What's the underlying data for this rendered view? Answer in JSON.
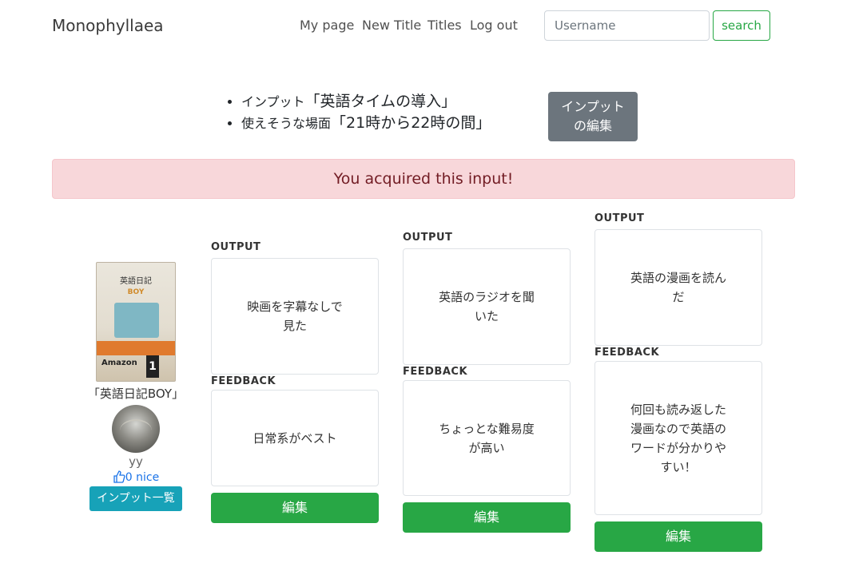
{
  "navbar": {
    "brand": "Monophyllaea",
    "links": [
      "My page",
      "New Title",
      "Titles",
      "Log out"
    ],
    "search_placeholder": "Username",
    "search_button": "search"
  },
  "input_info": {
    "input_prefix": "インプット",
    "input_value": "「英語タイムの導入」",
    "scene_prefix": "使えそうな場面",
    "scene_value": "「21時から22時の間」",
    "edit_button_line1": "インプット",
    "edit_button_line2": "の編集"
  },
  "alert": "You acquired this input!",
  "profile": {
    "book_label": "「英語日記BOY」",
    "book_cover_title": "英語日記",
    "book_cover_subtitle": "BOY",
    "book_cover_amazon": "Amazon",
    "book_cover_number": "1",
    "username": "yy",
    "nice": "0 nice",
    "list_button": "インプット一覧"
  },
  "records": [
    {
      "output_label": "OUTPUT",
      "output": "映画を字幕なしで見た",
      "feedback_label": "FEEDBACK",
      "feedback": "日常系がベスト",
      "edit": "編集"
    },
    {
      "output_label": "OUTPUT",
      "output": "英語のラジオを聞いた",
      "feedback_label": "FEEDBACK",
      "feedback": "ちょっとな難易度が高い",
      "edit": "編集"
    },
    {
      "output_label": "OUTPUT",
      "output": "英語の漫画を読んだ",
      "feedback_label": "FEEDBACK",
      "feedback": "何回も読み返した漫画なので英語のワードが分かりやすい！",
      "edit": "編集"
    }
  ],
  "colors": {
    "alert_bg": "#f8d7da",
    "alert_text": "#721c24",
    "success": "#28a745",
    "info": "#17a2b8",
    "secondary": "#6c757d",
    "link": "#1a73e8"
  }
}
